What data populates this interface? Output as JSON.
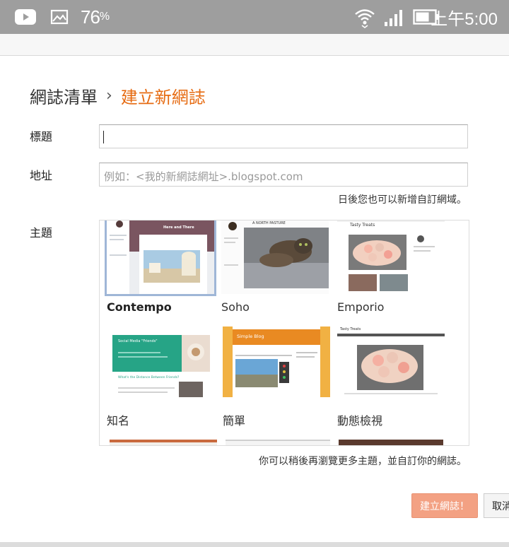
{
  "status_bar": {
    "battery_percent": "76",
    "percent_sign": "%",
    "time": "上午5:00",
    "icons": [
      "youtube-icon",
      "image-icon",
      "wifi-icon",
      "signal-icon",
      "battery-icon"
    ]
  },
  "breadcrumb": {
    "root": "網誌清單",
    "separator": "›",
    "current": "建立新網誌"
  },
  "form": {
    "title_label": "標題",
    "title_value": "",
    "address_label": "地址",
    "address_placeholder": "例如：<我的新網誌網址>.blogspot.com",
    "address_hint": "日後您也可以新增自訂網域。",
    "theme_label": "主題",
    "themes": [
      {
        "name": "Contempo",
        "selected": true
      },
      {
        "name": "Soho",
        "selected": false
      },
      {
        "name": "Emporio",
        "selected": false
      },
      {
        "name": "知名",
        "selected": false
      },
      {
        "name": "簡單",
        "selected": false
      },
      {
        "name": "動態檢視",
        "selected": false
      }
    ],
    "theme_hint": "你可以稍後再瀏覽更多主題，並自訂你的網誌。"
  },
  "thumb_text": {
    "contempo_title": "Here and There",
    "soho_header": "A NORTH PASTURE",
    "emporio_title": "Tasty Treats",
    "notable_title": "Social Media \"Friends\"",
    "notable_subtitle": "What's the Distance Between Friends?",
    "simple_title": "Simple Blog",
    "dynamic_title": "Tasty Treats"
  },
  "actions": {
    "create_label": "建立網誌！",
    "cancel_label": "取消"
  },
  "colors": {
    "accent_orange": "#e66b12",
    "create_button": "#f3a183",
    "status_bar": "#9e9e9e",
    "selected_outline": "#9fb6d7"
  }
}
